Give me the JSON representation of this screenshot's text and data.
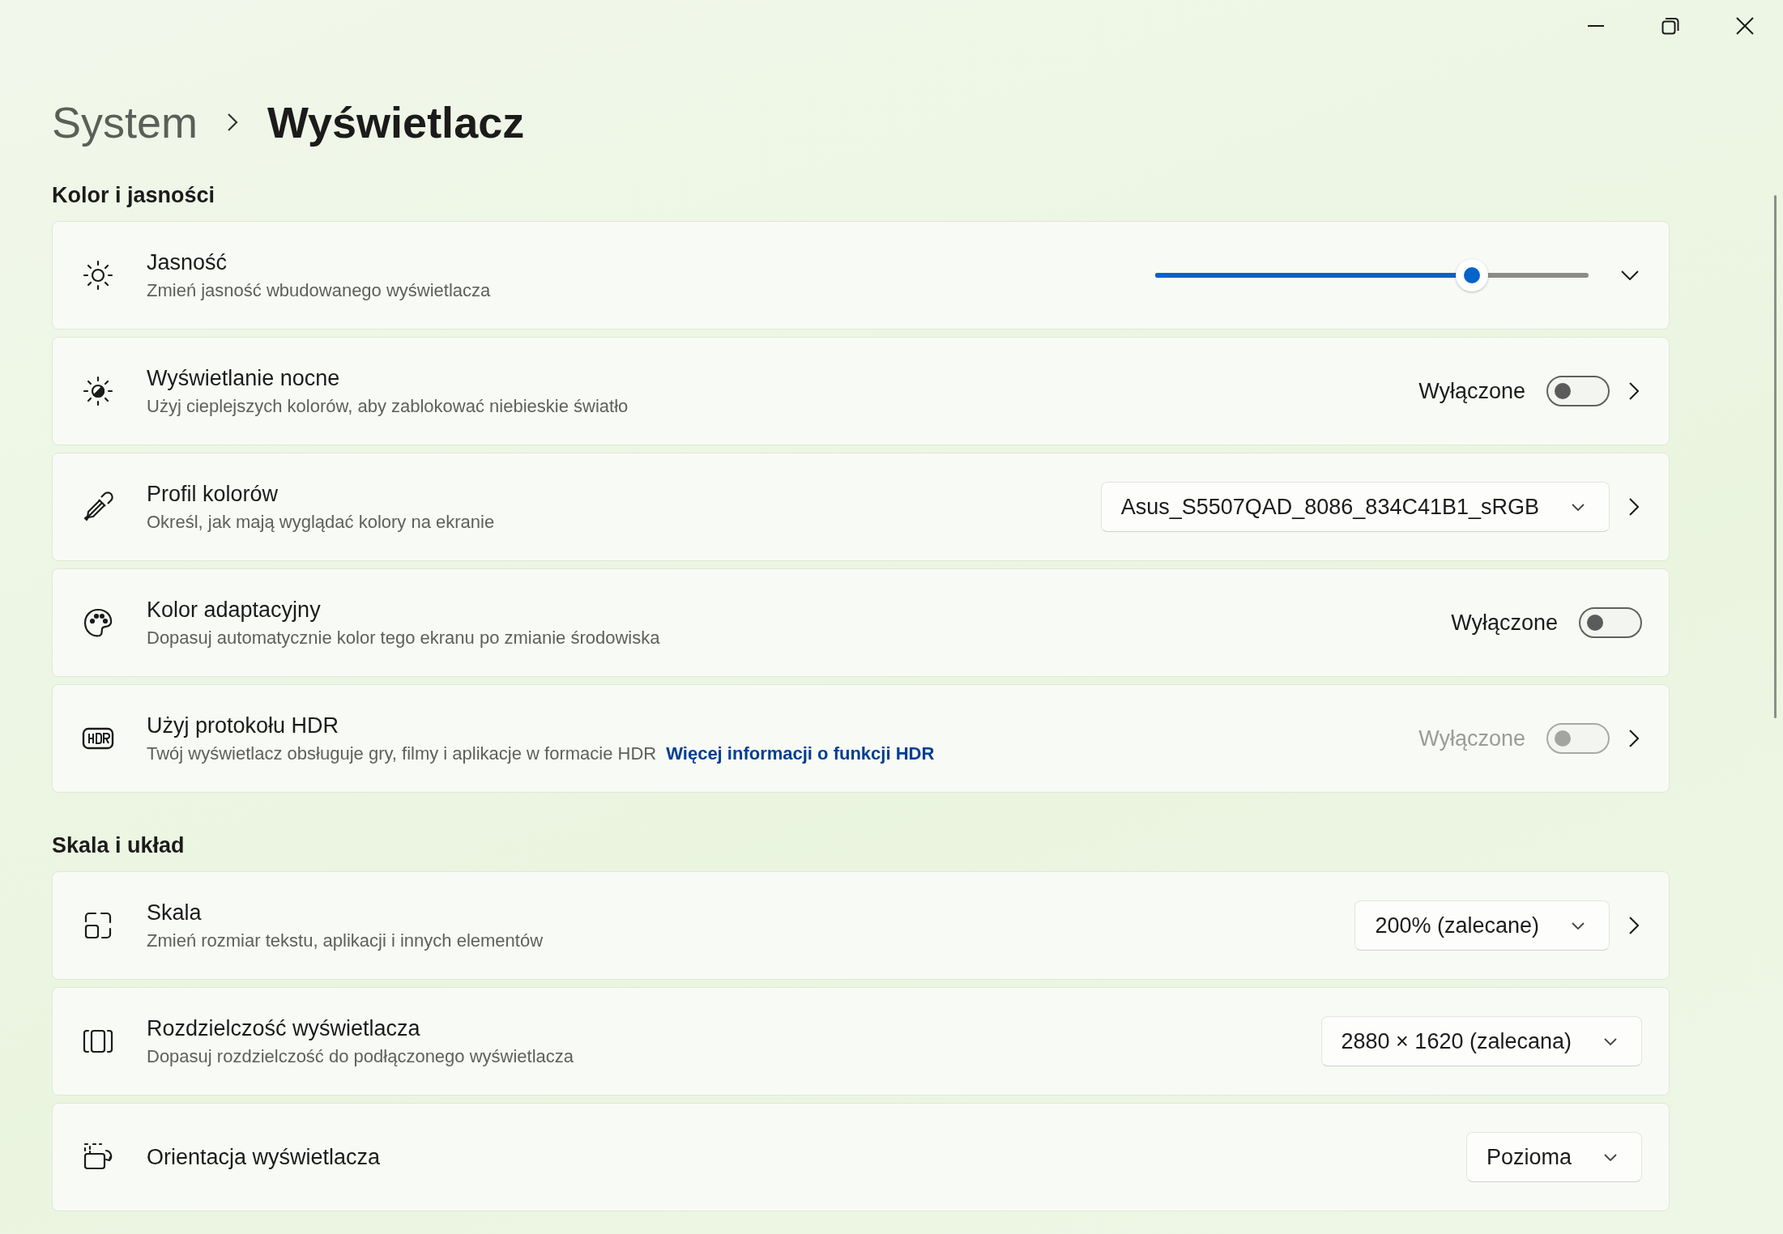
{
  "breadcrumb": [
    "System",
    "Wyświetlacz"
  ],
  "sections": [
    {
      "title": "Kolor i jasności",
      "settings": [
        {
          "kind": "slider",
          "title": "Jasność",
          "description": "Zmień jasność wbudowanego wyświetlacza",
          "level": 0.73,
          "expanded": false
        },
        {
          "kind": "toggle",
          "title": "Wyświetlanie nocne",
          "description": "Użyj cieplejszych kolorów, aby zablokować niebieskie światło",
          "status": "Wyłączone",
          "on": false,
          "disabled": false,
          "navigates": true
        },
        {
          "kind": "dropdown",
          "title": "Profil kolorów",
          "description": "Określ, jak mają wyglądać kolory na ekranie",
          "value": "Asus_S5507QAD_8086_834C41B1_sRGB",
          "navigates": true
        },
        {
          "kind": "toggle",
          "title": "Kolor adaptacyjny",
          "description": "Dopasuj automatycznie kolor tego ekranu po zmianie środowiska",
          "status": "Wyłączone",
          "on": false,
          "disabled": false,
          "navigates": false
        },
        {
          "kind": "toggle",
          "title": "Użyj protokołu HDR",
          "description": "Twój wyświetlacz obsługuje gry, filmy i aplikacje w formacie HDR",
          "link": "Więcej informacji o funkcji HDR",
          "status": "Wyłączone",
          "on": false,
          "disabled": true,
          "navigates": true
        }
      ]
    },
    {
      "title": "Skala i układ",
      "settings": [
        {
          "kind": "dropdown",
          "title": "Skala",
          "description": "Zmień rozmiar tekstu, aplikacji i innych elementów",
          "value": "200% (zalecane)",
          "navigates": true
        },
        {
          "kind": "dropdown",
          "title": "Rozdzielczość wyświetlacza",
          "description": "Dopasuj rozdzielczość do podłączonego wyświetlacza",
          "value": "2880 × 1620 (zalecana)",
          "navigates": false
        },
        {
          "kind": "dropdown",
          "title": "Orientacja wyświetlacza",
          "value": "Pozioma",
          "navigates": false
        }
      ]
    }
  ]
}
